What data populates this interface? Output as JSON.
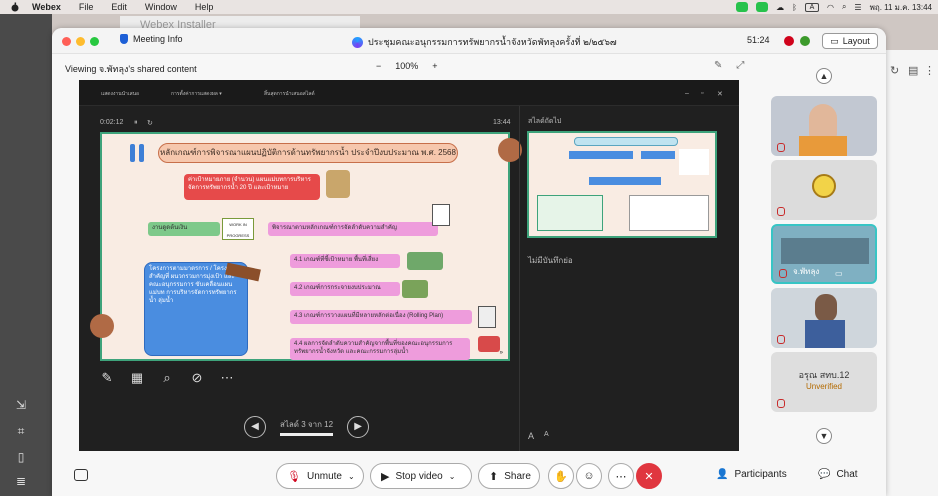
{
  "menubar": {
    "app": "Webex",
    "items": [
      "File",
      "Edit",
      "Window",
      "Help"
    ],
    "datetime": "พฤ. 11 ม.ค.  13:44"
  },
  "background": {
    "window_title": "Webex Installer"
  },
  "titlebar": {
    "meeting_info": "Meeting Info",
    "meeting_title": "ประชุมคณะอนุกรรมการทรัพยากรน้ำจังหวัดพัทลุงครั้งที่ ๒/๒๕๖๗",
    "timer": "51:24",
    "layout_label": "Layout"
  },
  "sharebar": {
    "viewing": "Viewing จ.พัทลุง's shared content",
    "zoom_minus": "−",
    "zoom_level": "100%",
    "zoom_plus": "+"
  },
  "presenter": {
    "top_items": [
      "แสดงงานนำเสนอ",
      "การตั้งค่าการแสดงผล ▾",
      "สิ้นสุดการนำเสนอสไลด์"
    ],
    "elapsed": "0:02:12",
    "clock": "13:44",
    "next_slide_label": "สไลด์ถัดไป",
    "no_notes": "ไม่มีบันทึกย่อ",
    "slide_counter": "สไลด์ 3 จาก 12",
    "font_smaller": "A",
    "font_larger": "A"
  },
  "slide": {
    "header": "หลักเกณฑ์การพิจารณาแผนปฏิบัติการด้านทรัพยากรน้ำ ประจำปีงบประมาณ พ.ศ. 2568",
    "item1": "ค่าเป้าหมายภาย (จำนวน) แผนแม่บทการบริหารจัดการทรัพยากรน้ำ 20 ปี และเป้าหมาย",
    "item2": "งานดูดต้นเงิน",
    "item3": "พิจารณาตามหลักเกณฑ์การจัดลำดับความสำคัญ",
    "item3_stamp": "WORK IN PROGRESS",
    "blue_box": "โครงการตามมาตรการ / โครงการสำคัญที่ ผนวกรวมการมุ่งเป้า และ คณะอนุกรรมการ ขับเคลื่อนแผนแม่บท การบริหารจัดการทรัพยากรน้ำ ลุ่มน้ำ",
    "sub1": "4.1 เกณฑ์ที่ชี้เป้าหมาย พื้นที่เสี่ยง",
    "sub2": "4.2 เกณฑ์การกระจายงบประมาณ",
    "sub3": "4.3 เกณฑ์การวางแผนที่มีหลายหลักต่อเนื่อง (Rolling Plan)",
    "sub4": "4.4 ผลการจัดลำดับความสำคัญจากพื้นที่ของคณะอนุกรรมการทรัพยากรน้ำจังหวัด และคณะกรรมการลุ่มน้ำ",
    "page_mark": "»"
  },
  "participants": [
    {
      "name": "",
      "subname": ""
    },
    {
      "name": "",
      "subname": ""
    },
    {
      "name": "จ.พัทลุง",
      "subname": ""
    },
    {
      "name": "",
      "subname": ""
    },
    {
      "name": "",
      "subname": "อรุณ สทบ.12",
      "status": "Unverified"
    }
  ],
  "controls": {
    "unmute": "Unmute",
    "stop_video": "Stop video",
    "share": "Share",
    "participants": "Participants",
    "chat": "Chat"
  },
  "colors": {
    "accent_green": "#3ea37b",
    "leave_red": "#e0363f",
    "active_tile": "#37c5c5"
  }
}
